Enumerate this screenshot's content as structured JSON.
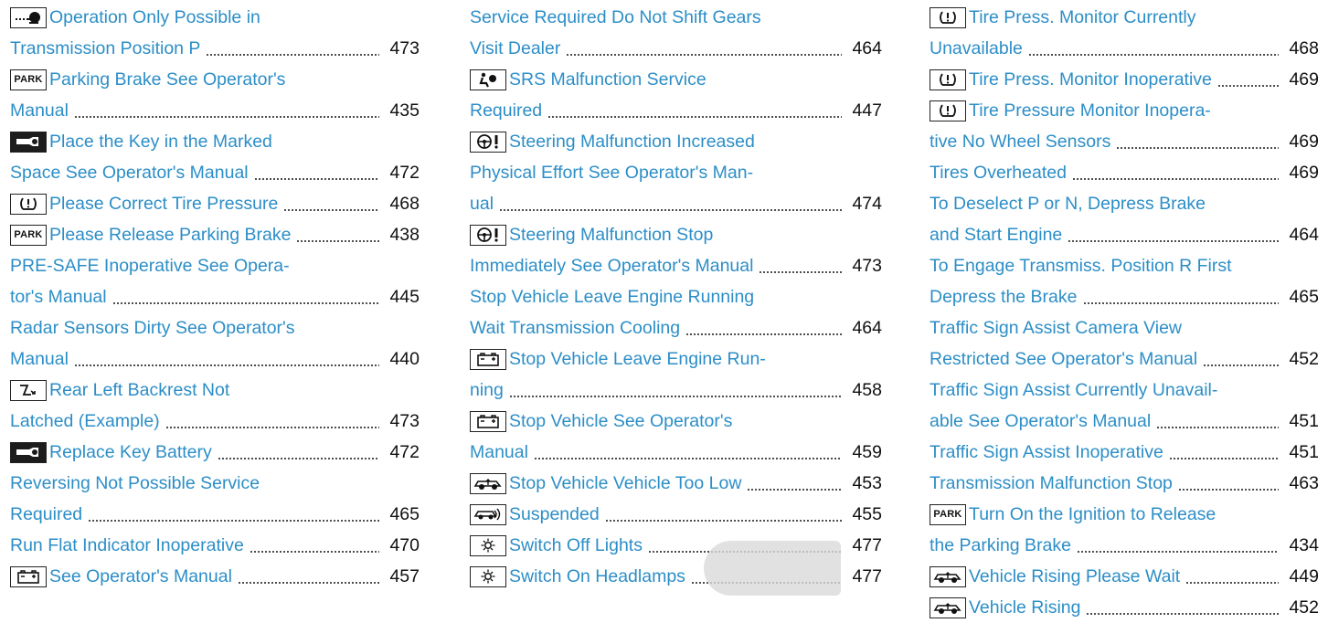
{
  "columns": [
    [
      {
        "icon": "transmission-p-icon",
        "text": "Operation Only Possible in",
        "page": ""
      },
      {
        "icon": "",
        "text": "Transmission Position P",
        "page": "473"
      },
      {
        "icon": "park-icon",
        "text": "Parking Brake See Operator's",
        "page": ""
      },
      {
        "icon": "",
        "text": "Manual",
        "page": "435"
      },
      {
        "icon": "key-icon",
        "text": "Place the Key in the Marked",
        "page": ""
      },
      {
        "icon": "",
        "text": "Space See Operator's Manual",
        "page": "472"
      },
      {
        "icon": "tire-pressure-icon",
        "text": "Please Correct Tire Pressure",
        "page": "468"
      },
      {
        "icon": "park-icon",
        "text": "Please Release Parking Brake",
        "page": "438"
      },
      {
        "icon": "",
        "text": "PRE-SAFE Inoperative See Opera-",
        "page": ""
      },
      {
        "icon": "",
        "text": "tor's Manual",
        "page": "445"
      },
      {
        "icon": "",
        "text": "Radar Sensors Dirty See Operator's",
        "page": ""
      },
      {
        "icon": "",
        "text": "Manual",
        "page": "440"
      },
      {
        "icon": "seat-backrest-icon",
        "text": "Rear Left Backrest Not",
        "page": ""
      },
      {
        "icon": "",
        "text": "Latched (Example)",
        "page": "473"
      },
      {
        "icon": "key-icon",
        "text": "Replace Key Battery",
        "page": "472"
      },
      {
        "icon": "",
        "text": "Reversing Not Possible Service",
        "page": ""
      },
      {
        "icon": "",
        "text": "Required",
        "page": "465"
      },
      {
        "icon": "",
        "text": "Run Flat Indicator Inoperative",
        "page": "470"
      },
      {
        "icon": "battery-icon",
        "text": "See Operator's Manual",
        "page": "457"
      }
    ],
    [
      {
        "icon": "",
        "text": "Service Required Do Not Shift Gears",
        "page": ""
      },
      {
        "icon": "",
        "text": "Visit Dealer",
        "page": "464"
      },
      {
        "icon": "srs-airbag-icon",
        "text": "SRS Malfunction Service",
        "page": ""
      },
      {
        "icon": "",
        "text": "Required",
        "page": "447"
      },
      {
        "icon": "steering-warning-icon",
        "text": "Steering Malfunction Increased",
        "page": ""
      },
      {
        "icon": "",
        "text": "Physical Effort See Operator's Man-",
        "page": ""
      },
      {
        "icon": "",
        "text": "ual",
        "page": "474"
      },
      {
        "icon": "steering-warning-icon",
        "text": "Steering Malfunction Stop",
        "page": ""
      },
      {
        "icon": "",
        "text": "Immediately See Operator's Manual",
        "page": "473"
      },
      {
        "icon": "",
        "text": "Stop Vehicle Leave Engine Running",
        "page": ""
      },
      {
        "icon": "",
        "text": "Wait Transmission Cooling",
        "page": "464"
      },
      {
        "icon": "battery-icon",
        "text": "Stop Vehicle Leave Engine Run-",
        "page": ""
      },
      {
        "icon": "",
        "text": "ning",
        "page": "458"
      },
      {
        "icon": "battery-icon",
        "text": "Stop Vehicle See Operator's",
        "page": ""
      },
      {
        "icon": "",
        "text": "Manual",
        "page": "459"
      },
      {
        "icon": "vehicle-level-icon",
        "text": "Stop Vehicle Vehicle Too Low",
        "page": "453"
      },
      {
        "icon": "suspension-icon",
        "text": "Suspended",
        "page": "455"
      },
      {
        "icon": "lights-icon",
        "text": "Switch Off Lights",
        "page": "477"
      },
      {
        "icon": "lights-icon",
        "text": "Switch On Headlamps",
        "page": "477"
      }
    ],
    [
      {
        "icon": "tire-pressure-icon",
        "text": "Tire Press. Monitor Currently",
        "page": ""
      },
      {
        "icon": "",
        "text": "Unavailable",
        "page": "468"
      },
      {
        "icon": "tire-pressure-icon",
        "text": "Tire Press. Monitor Inoperative",
        "page": "469"
      },
      {
        "icon": "tire-pressure-icon",
        "text": "Tire Pressure Monitor Inopera-",
        "page": ""
      },
      {
        "icon": "",
        "text": "tive No Wheel Sensors",
        "page": "469"
      },
      {
        "icon": "",
        "text": "Tires Overheated",
        "page": "469"
      },
      {
        "icon": "",
        "text": "To Deselect P or N, Depress Brake",
        "page": ""
      },
      {
        "icon": "",
        "text": "and Start Engine",
        "page": "464"
      },
      {
        "icon": "",
        "text": "To Engage Transmiss. Position R First",
        "page": ""
      },
      {
        "icon": "",
        "text": "Depress the Brake",
        "page": "465"
      },
      {
        "icon": "",
        "text": "Traffic Sign Assist Camera View",
        "page": ""
      },
      {
        "icon": "",
        "text": "Restricted See Operator's Manual",
        "page": "452"
      },
      {
        "icon": "",
        "text": "Traffic Sign Assist Currently Unavail-",
        "page": ""
      },
      {
        "icon": "",
        "text": "able See Operator's Manual",
        "page": "451"
      },
      {
        "icon": "",
        "text": "Traffic Sign Assist Inoperative",
        "page": "451"
      },
      {
        "icon": "",
        "text": "Transmission Malfunction Stop",
        "page": "463"
      },
      {
        "icon": "park-icon",
        "text": "Turn On the Ignition to Release",
        "page": ""
      },
      {
        "icon": "",
        "text": "the Parking Brake",
        "page": "434"
      },
      {
        "icon": "vehicle-level-icon",
        "text": "Vehicle Rising Please Wait",
        "page": "449"
      },
      {
        "icon": "vehicle-level-icon",
        "text": "Vehicle Rising",
        "page": "452"
      }
    ]
  ],
  "park_badge_text": "PARK",
  "colors": {
    "entry_text": "#2c8ec7",
    "page_number": "#111111",
    "leader_dots": "#222222"
  }
}
